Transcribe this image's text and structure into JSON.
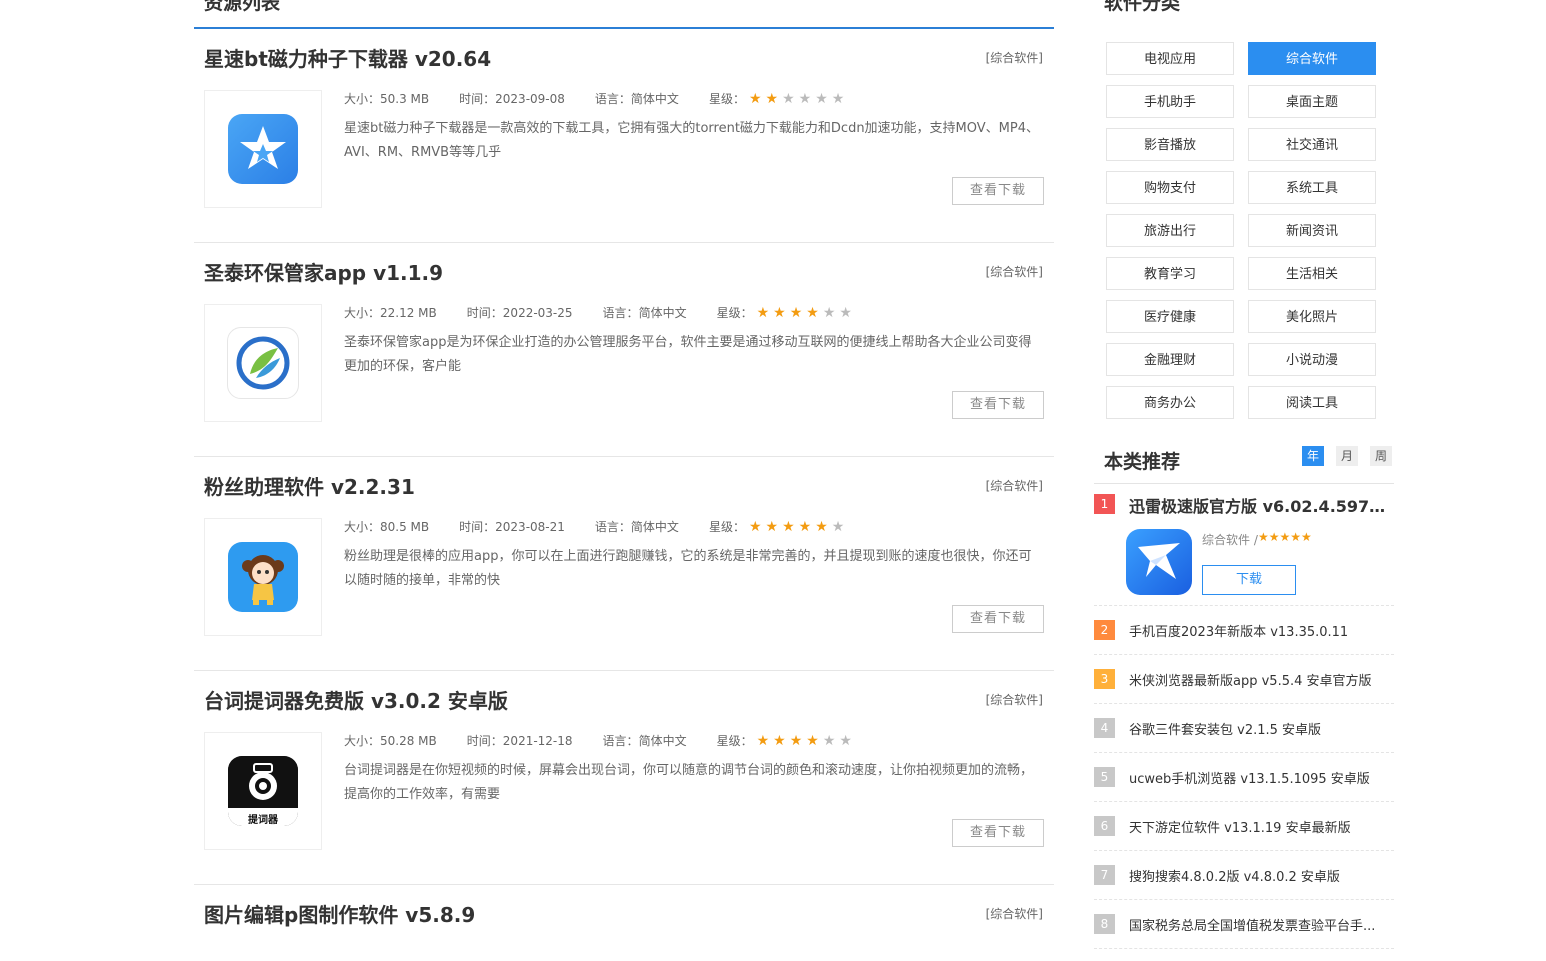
{
  "main": {
    "section_title": "资源列表",
    "items": [
      {
        "title": "星速bt磁力种子下载器 v20.64",
        "category": "[综合软件]",
        "size_label": "大小：",
        "size": "50.3 MB",
        "time_label": "时间：",
        "time": "2023-09-08",
        "lang_label": "语言：",
        "lang": "简体中文",
        "rating_label": "星级：",
        "rating": 2,
        "desc": "星速bt磁力种子下载器是一款高效的下载工具，它拥有强大的torrent磁力下载能力和Dcdn加速功能，支持MOV、MP4、AVI、RM、RMVB等等几乎",
        "button": "查看下载",
        "icon": "star-app-icon"
      },
      {
        "title": "圣泰环保管家app v1.1.9",
        "category": "[综合软件]",
        "size_label": "大小：",
        "size": "22.12 MB",
        "time_label": "时间：",
        "time": "2022-03-25",
        "lang_label": "语言：",
        "lang": "简体中文",
        "rating_label": "星级：",
        "rating": 4,
        "desc": "圣泰环保管家app是为环保企业打造的办公管理服务平台，软件主要是通过移动互联网的便捷线上帮助各大企业公司变得更加的环保，客户能",
        "button": "查看下载",
        "icon": "leaf-app-icon"
      },
      {
        "title": "粉丝助理软件 v2.2.31",
        "category": "[综合软件]",
        "size_label": "大小：",
        "size": "80.5 MB",
        "time_label": "时间：",
        "time": "2023-08-21",
        "lang_label": "语言：",
        "lang": "简体中文",
        "rating_label": "星级：",
        "rating": 5,
        "desc": "粉丝助理是很棒的应用app，你可以在上面进行跑腿赚钱，它的系统是非常完善的，并且提现到账的速度也很快，你还可以随时随的接单，非常的快",
        "button": "查看下载",
        "icon": "girl-app-icon"
      },
      {
        "title": "台词提词器免费版 v3.0.2 安卓版",
        "category": "[综合软件]",
        "size_label": "大小：",
        "size": "50.28 MB",
        "time_label": "时间：",
        "time": "2021-12-18",
        "lang_label": "语言：",
        "lang": "简体中文",
        "rating_label": "星级：",
        "rating": 4,
        "desc": "台词提词器是在你短视频的时候，屏幕会出现台词，你可以随意的调节台词的颜色和滚动速度，让你拍视频更加的流畅，提高你的工作效率，有需要",
        "button": "查看下载",
        "icon": "camera-app-icon",
        "icon_text": "提词器"
      },
      {
        "title": "图片编辑p图制作软件 v5.8.9",
        "category": "[综合软件]"
      }
    ]
  },
  "sidebar": {
    "category_title": "软件分类",
    "categories": [
      "电视应用",
      "综合软件",
      "手机助手",
      "桌面主题",
      "影音播放",
      "社交通讯",
      "购物支付",
      "系统工具",
      "旅游出行",
      "新闻资讯",
      "教育学习",
      "生活相关",
      "医疗健康",
      "美化照片",
      "金融理财",
      "小说动漫",
      "商务办公",
      "阅读工具"
    ],
    "active_category": "综合软件",
    "rec_title": "本类推荐",
    "tabs": [
      "年",
      "月",
      "周"
    ],
    "active_tab": "年",
    "featured": {
      "rank": "1",
      "name": "迅雷极速版官方版 v6.02.4.5972 ...",
      "category": "综合软件 /",
      "stars": "★★★★★",
      "button": "下载"
    },
    "ranks": [
      {
        "rank": "2",
        "name": "手机百度2023年新版本 v13.35.0.11"
      },
      {
        "rank": "3",
        "name": "米侠浏览器最新版app v5.5.4 安卓官方版"
      },
      {
        "rank": "4",
        "name": "谷歌三件套安装包 v2.1.5 安卓版"
      },
      {
        "rank": "5",
        "name": "ucweb手机浏览器 v13.1.5.1095 安卓版"
      },
      {
        "rank": "6",
        "name": "天下游定位软件 v13.1.19 安卓最新版"
      },
      {
        "rank": "7",
        "name": "搜狗搜索4.8.0.2版 v4.8.0.2 安卓版"
      },
      {
        "rank": "8",
        "name": "国家税务总局全国增值税发票查验平台手..."
      }
    ],
    "rank_colors": {
      "1": "#f25555",
      "2": "#ff8a3d",
      "3": "#ffb03a",
      "other": "#c8c8c8"
    }
  }
}
